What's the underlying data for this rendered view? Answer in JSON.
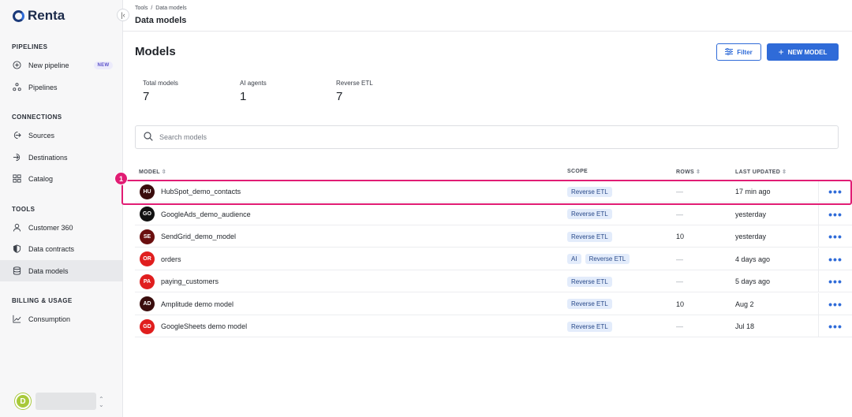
{
  "brand": {
    "name": "Renta"
  },
  "sidebar": {
    "collapse_icon": "chevron-left-bar-icon",
    "sections": [
      {
        "title": "PIPELINES"
      },
      {
        "title": "CONNECTIONS"
      },
      {
        "title": "TOOLS"
      },
      {
        "title": "BILLING & USAGE"
      }
    ],
    "items": [
      {
        "label": "New pipeline",
        "icon": "plus-circle-icon",
        "badge": "NEW"
      },
      {
        "label": "Pipelines",
        "icon": "pipelines-icon"
      },
      {
        "label": "Sources",
        "icon": "source-icon"
      },
      {
        "label": "Destinations",
        "icon": "destination-icon"
      },
      {
        "label": "Catalog",
        "icon": "grid-icon"
      },
      {
        "label": "Customer 360",
        "icon": "user-icon"
      },
      {
        "label": "Data contracts",
        "icon": "shield-icon"
      },
      {
        "label": "Data models",
        "icon": "database-icon",
        "active": true
      },
      {
        "label": "Consumption",
        "icon": "chart-icon"
      }
    ],
    "user": {
      "initial": "D"
    }
  },
  "header": {
    "breadcrumb": [
      "Tools",
      "/",
      "Data models"
    ],
    "title": "Data models"
  },
  "main": {
    "title": "Models",
    "filter_label": "Filter",
    "new_model_label": "NEW MODEL",
    "stats": [
      {
        "label": "Total models",
        "value": "7"
      },
      {
        "label": "AI agents",
        "value": "1"
      },
      {
        "label": "Reverse ETL",
        "value": "7"
      }
    ],
    "search": {
      "placeholder": "Search models"
    }
  },
  "table": {
    "columns": [
      "MODEL",
      "SCOPE",
      "ROWS",
      "LAST UPDATED"
    ],
    "rows": [
      {
        "initials": "HU",
        "name": "HubSpot_demo_contacts",
        "scope": [
          "Reverse ETL"
        ],
        "rows": "—",
        "updated": "17 min ago",
        "color": "#3a0d0d"
      },
      {
        "initials": "GO",
        "name": "GoogleAds_demo_audience",
        "scope": [
          "Reverse ETL"
        ],
        "rows": "—",
        "updated": "yesterday",
        "color": "#111111"
      },
      {
        "initials": "SE",
        "name": "SendGrid_demo_model",
        "scope": [
          "Reverse ETL"
        ],
        "rows": "10",
        "updated": "yesterday",
        "color": "#6b0f0f"
      },
      {
        "initials": "OR",
        "name": "orders",
        "scope": [
          "AI",
          "Reverse ETL"
        ],
        "rows": "—",
        "updated": "4 days ago",
        "color": "#e01e1e"
      },
      {
        "initials": "PA",
        "name": "paying_customers",
        "scope": [
          "Reverse ETL"
        ],
        "rows": "—",
        "updated": "5 days ago",
        "color": "#e01e1e"
      },
      {
        "initials": "AD",
        "name": "Amplitude demo model",
        "scope": [
          "Reverse ETL"
        ],
        "rows": "10",
        "updated": "Aug 2",
        "color": "#3a0d0d"
      },
      {
        "initials": "GD",
        "name": "GoogleSheets demo model",
        "scope": [
          "Reverse ETL"
        ],
        "rows": "—",
        "updated": "Jul 18",
        "color": "#e01e1e"
      }
    ]
  },
  "annotation": {
    "marker": "1",
    "color": "#e11d74"
  }
}
